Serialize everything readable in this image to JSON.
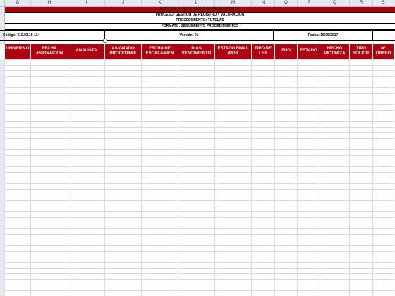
{
  "columns": [
    "G",
    "H",
    "I",
    "J",
    "K",
    "L",
    "M",
    "N",
    "O",
    "P",
    "Q",
    "R",
    "S"
  ],
  "header_band": {
    "title": "SISTEMA INTEGRADO DE GESTION",
    "proceso": "PROCESO: GESTIÓN DE REGISTRO Y VALORACIÓN",
    "procedimiento": "PROCEDIMIENTO: TUTELAS",
    "formato": "FORMATO: SEGUIMIENTO PROCEDIMIENTOS"
  },
  "meta": {
    "codigo": "Código: 310.03.15-114",
    "version": "Versión: 01",
    "fecha": "Fecha: 15/05/2017"
  },
  "table_headers": [
    "UNIVERS O",
    "FECHA ASIGNACION",
    "ANALISTA",
    "ASIGNADO PROCEDIMIE",
    "FECHA DE ESCALAMIEN",
    "DIAS VENCIMIENTO",
    "ESTADO FINAL (POR",
    "TIPO DE LEY",
    "FUD",
    "ESTADO",
    "HECHO VICTIMIZA",
    "TIPO SOLICIT",
    "N° ORFEO"
  ],
  "colors": {
    "header_red": "#b00010",
    "title_red": "#a8000c",
    "grid": "#d6dce4"
  }
}
